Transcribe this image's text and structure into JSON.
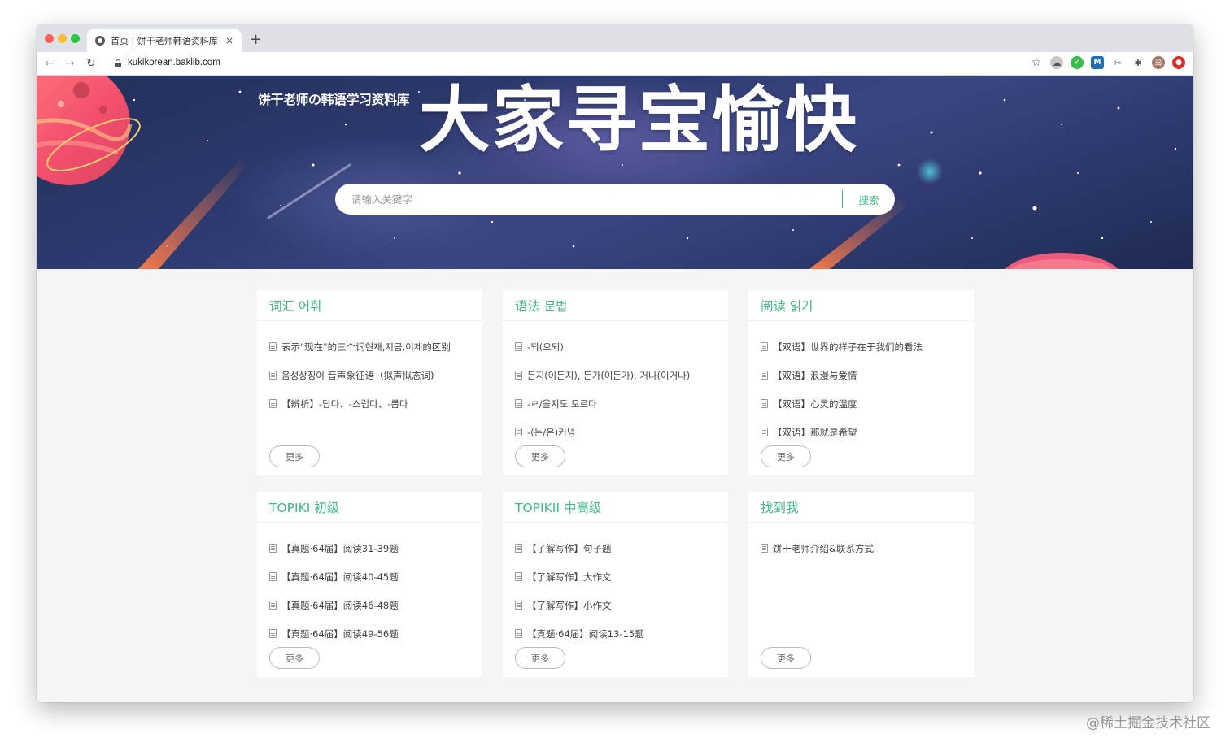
{
  "browser": {
    "tab_title": "首页 | 饼干老师韩语资料库",
    "tab_close": "×",
    "new_tab": "+",
    "url": "kukikorean.baklib.com",
    "back": "←",
    "forward": "→",
    "reload": "↻",
    "star": "☆",
    "ext_gray": "☁",
    "ext_green": "✓",
    "ext_m": "M",
    "ext_cut": "✂",
    "ext_puzzle": "✱",
    "ext_avatar": "阅",
    "ext_red": "●"
  },
  "site": {
    "logo": "饼干老师の韩语学习资料库",
    "hero_title": "大家寻宝愉快",
    "search": {
      "placeholder": "请输入关键字",
      "button": "搜索"
    }
  },
  "cards": [
    {
      "title": "词汇 어휘",
      "items": [
        "表示\"现在\"的三个词현재,지금,이제的区别",
        "음성상징어 音声象征语（拟声拟态词)",
        "【辨析】-답다、-스럽다、-롭다"
      ],
      "more": "更多"
    },
    {
      "title": "语法 문법",
      "items": [
        "-되(으되)",
        "든지(이든지), 든가(이든가), 거나(이거나)",
        "-ㄹ/을지도 모르다",
        "-(는/은)커녕"
      ],
      "more": "更多"
    },
    {
      "title": "阅读 읽기",
      "items": [
        "【双语】世界的样子在于我们的看法",
        "【双语】浪漫与爱情",
        "【双语】心灵的温度",
        "【双语】那就是希望"
      ],
      "more": "更多"
    },
    {
      "title": "TOPIKI 初级",
      "items": [
        "【真题·64届】阅读31-39题",
        "【真题·64届】阅读40-45题",
        "【真题·64届】阅读46-48题",
        "【真题·64届】阅读49-56题"
      ],
      "more": "更多"
    },
    {
      "title": "TOPIKII 中高级",
      "items": [
        "【了解写作】句子题",
        "【了解写作】大作文",
        "【了解写作】小作文",
        "【真题·64届】阅读13-15题"
      ],
      "more": "更多"
    },
    {
      "title": "找到我",
      "items": [
        "饼干老师介绍&联系方式"
      ],
      "more": "更多"
    }
  ],
  "watermark": "@稀土掘金技术社区",
  "colors": {
    "accent": "#42b983",
    "banner": "#2d3a6e",
    "planet": "#ff6b6b"
  }
}
